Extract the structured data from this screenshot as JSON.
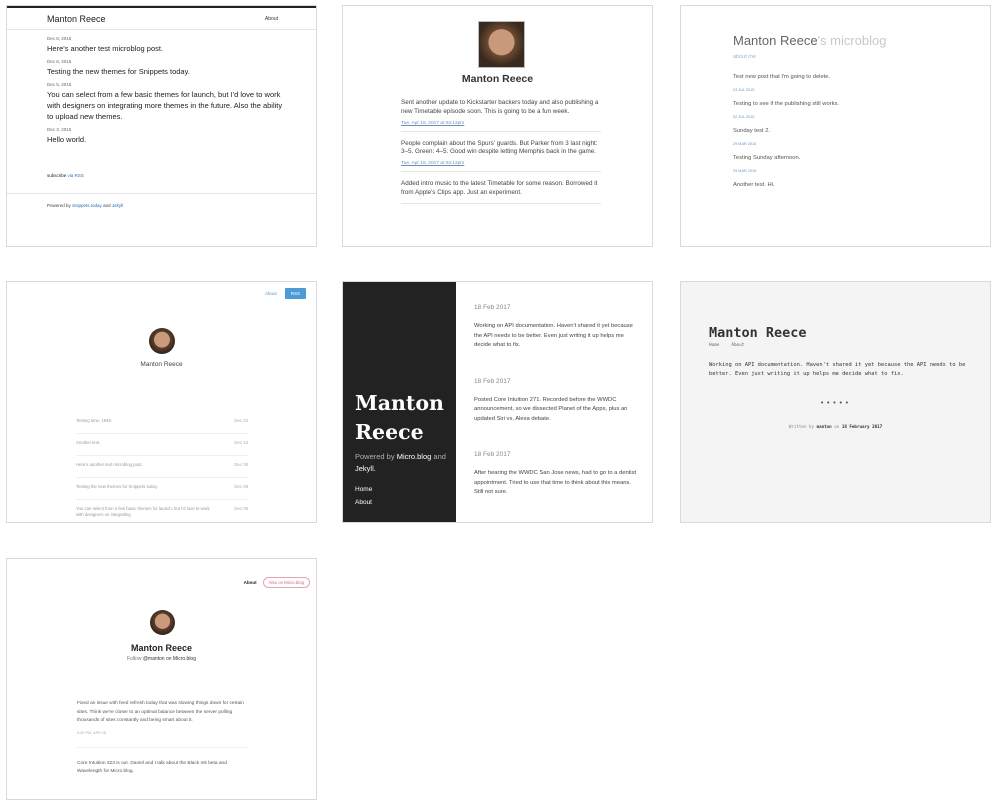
{
  "theme1": {
    "name": "Manton Reece",
    "about": "About",
    "posts": [
      {
        "date": "Dec 8, 2015",
        "text": "Here's another test microblog post."
      },
      {
        "date": "Dec 6, 2015",
        "text": "Testing the new themes for Snippets today."
      },
      {
        "date": "Dec 5, 2015",
        "text": "You can select from a few basic themes for launch, but I'd love to work with designers on integrating more themes in the future. Also the ability to upload new themes."
      },
      {
        "date": "Dec 3, 2015",
        "text": "Hello world."
      }
    ],
    "subscribe_text": "subscribe",
    "subscribe_link": "via RSS",
    "powered_prefix": "Powered by",
    "powered_link1": "Snippets.today",
    "powered_and": "and",
    "powered_link2": "Jekyll"
  },
  "theme2": {
    "name": "Manton Reece",
    "posts": [
      {
        "text": "Sent another update to Kickstarter backers today and also publishing a new Timetable episode soon. This is going to be a fun week.",
        "date": "Tue, Apr 18, 2017 at 04:12pm"
      },
      {
        "text": "People complain about the Spurs' guards. But Parker from 3 last night: 3–5. Green: 4–5. Good win despite letting Memphis back in the game.",
        "date": "Tue, Apr 18, 2017 at 04:12pm"
      },
      {
        "text": "Added intro music to the latest Timetable for some reason. Borrowed it from Apple's Clips app. Just an experiment.",
        "date": ""
      }
    ]
  },
  "theme3": {
    "name": "Manton Reece",
    "suffix": "'s microblog",
    "about": "about me",
    "posts": [
      {
        "text": "Test new post that I'm going to delete.",
        "date": "24 JUL 2015"
      },
      {
        "text": "Testing to see if the publishing still works.",
        "date": "02 JUL 2015"
      },
      {
        "text": "Sunday test 2.",
        "date": "29 MAR 2015"
      },
      {
        "text": "Testing Sunday afternoon.",
        "date": "29 MAR 2015"
      },
      {
        "text": "Another test. Hi.",
        "date": ""
      }
    ]
  },
  "theme4": {
    "about": "About",
    "rss": "RSS",
    "name": "Manton Reece",
    "posts": [
      {
        "text": "Testing time, 1949.",
        "date": "Dec 23"
      },
      {
        "text": "Another test.",
        "date": "Dec 13"
      },
      {
        "text": "Here's another test microblog post.",
        "date": "Dec 08"
      },
      {
        "text": "Testing the new themes for Snippets today.",
        "date": "Dec 06"
      },
      {
        "text": "You can select from a few basic themes for launch, but I'd love to work with designers on integrating",
        "date": "Dec 05"
      }
    ]
  },
  "theme5": {
    "title_line1": "Manton",
    "title_line2": "Reece",
    "powered_prefix": "Powered by",
    "powered_link1": "Micro.blog",
    "powered_and": "and",
    "powered_link2": "Jekyll.",
    "nav": [
      "Home",
      "About"
    ],
    "posts": [
      {
        "date": "18 Feb 2017",
        "text": "Working on API documentation. Haven't shared it yet because the API needs to be better. Even just writing it up helps me decide what to fix."
      },
      {
        "date": "18 Feb 2017",
        "text": "Posted Core Intuition 271. Recorded before the WWDC announcement, so we dissected Planet of the Apps, plus an updated Siri vs. Alexa debate."
      },
      {
        "date": "18 Feb 2017",
        "text": "After hearing the WWDC San Jose news, had to go to a dentist appointment. Tried to use that time to think about this means. Still not sure."
      }
    ]
  },
  "theme6": {
    "name": "Manton Reece",
    "nav": [
      "Home",
      "About"
    ],
    "text": "Working on API documentation. Haven't shared it yet because the API needs to be better. Even just writing it up helps me decide what to fix.",
    "dots": "•••••",
    "written_prefix": "Written by",
    "author": "manton",
    "on": "on",
    "date": "18 February 2017"
  },
  "theme7": {
    "about": "About",
    "button": "Also on Micro.blog",
    "name": "Manton Reece",
    "follow_prefix": "Follow",
    "follow_handle": "@manton on Micro.blog",
    "posts": [
      {
        "text": "Fixed an issue with feed refresh today that was slowing things down for certain sites. Think we're closer to an optimal balance between the server polling thousands of sites constantly and being smart about it.",
        "date": "4:39 PM, APR 18"
      },
      {
        "text": "Core Intuition 323 is out. Daniel and I talk about the Black Ink beta and Wavelength for Micro.blog.",
        "date": ""
      }
    ]
  }
}
